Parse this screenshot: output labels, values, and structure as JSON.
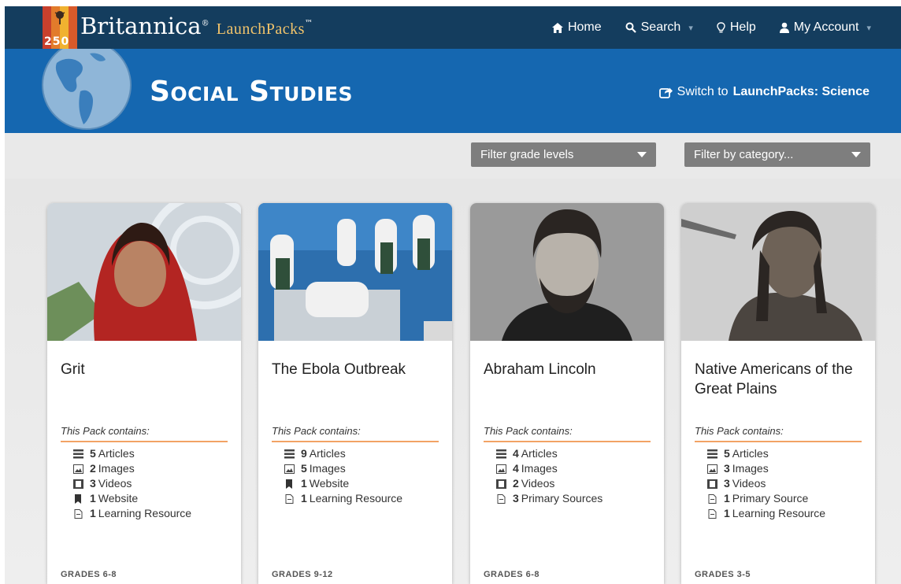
{
  "app": {
    "brand_name": "Britannica",
    "brand_product": "LaunchPacks",
    "logo_number": "250"
  },
  "nav": {
    "home": "Home",
    "search": "Search",
    "help": "Help",
    "account": "My Account"
  },
  "header": {
    "title": "Social Studies",
    "switch_prefix": "Switch to ",
    "switch_target": "LaunchPacks: Science"
  },
  "filters": {
    "grade": "Filter grade levels",
    "category": "Filter by category..."
  },
  "contains_label": "This Pack contains:",
  "cards": [
    {
      "title": "Grit",
      "grades": "GRADES 6-8",
      "items": [
        {
          "icon": "list-icon",
          "count": "5",
          "label": "Articles"
        },
        {
          "icon": "image-icon",
          "count": "2",
          "label": "Images"
        },
        {
          "icon": "video-icon",
          "count": "3",
          "label": "Videos"
        },
        {
          "icon": "bookmark-icon",
          "count": "1",
          "label": "Website"
        },
        {
          "icon": "document-icon",
          "count": "1",
          "label": "Learning Resource"
        }
      ]
    },
    {
      "title": "The Ebola Outbreak",
      "grades": "GRADES 9-12",
      "items": [
        {
          "icon": "list-icon",
          "count": "9",
          "label": "Articles"
        },
        {
          "icon": "image-icon",
          "count": "5",
          "label": "Images"
        },
        {
          "icon": "bookmark-icon",
          "count": "1",
          "label": "Website"
        },
        {
          "icon": "document-icon",
          "count": "1",
          "label": "Learning Resource"
        }
      ]
    },
    {
      "title": "Abraham Lincoln",
      "grades": "GRADES 6-8",
      "items": [
        {
          "icon": "list-icon",
          "count": "4",
          "label": "Articles"
        },
        {
          "icon": "image-icon",
          "count": "4",
          "label": "Images"
        },
        {
          "icon": "video-icon",
          "count": "2",
          "label": "Videos"
        },
        {
          "icon": "document-icon",
          "count": "3",
          "label": "Primary Sources"
        }
      ]
    },
    {
      "title": "Native Americans of the Great Plains",
      "grades": "GRADES 3-5",
      "items": [
        {
          "icon": "list-icon",
          "count": "5",
          "label": "Articles"
        },
        {
          "icon": "image-icon",
          "count": "3",
          "label": "Images"
        },
        {
          "icon": "video-icon",
          "count": "3",
          "label": "Videos"
        },
        {
          "icon": "document-icon",
          "count": "1",
          "label": "Primary Source"
        },
        {
          "icon": "document-icon",
          "count": "1",
          "label": "Learning Resource"
        }
      ]
    }
  ],
  "colors": {
    "topbar": "#143d5e",
    "header": "#1567b0",
    "accent_underline": "#f2a365",
    "filter_bg": "#7e7e7e"
  }
}
